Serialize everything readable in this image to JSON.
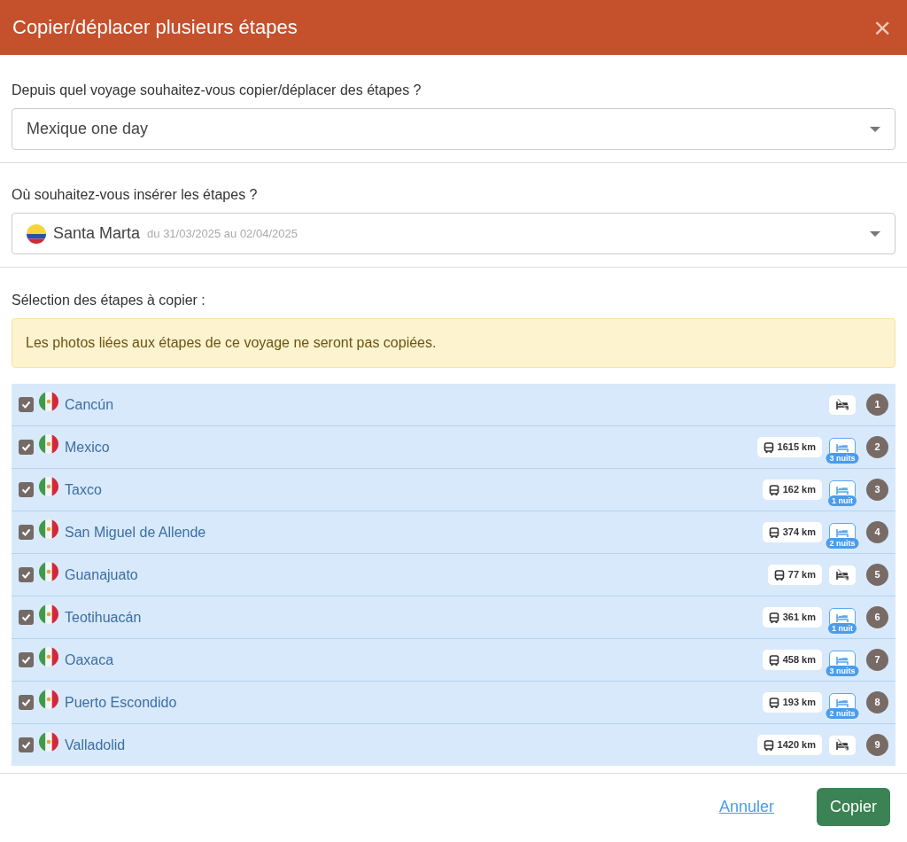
{
  "dialog": {
    "title": "Copier/déplacer plusieurs étapes",
    "close": "×"
  },
  "source": {
    "label": "Depuis quel voyage souhaitez-vous copier/déplacer des étapes ?",
    "value": "Mexique one day"
  },
  "target": {
    "label": "Où souhaitez-vous insérer les étapes ?",
    "value": "Santa Marta",
    "dates": "du 31/03/2025 au 02/04/2025"
  },
  "selection": {
    "label": "Sélection des étapes à copier :",
    "alert": "Les photos liées aux étapes de ce voyage ne seront pas copiées."
  },
  "steps": [
    {
      "name": "Cancún",
      "checked": true,
      "number": "1"
    },
    {
      "name": "Mexico",
      "checked": true,
      "distance": "1615 km",
      "nights": "3 nuits",
      "number": "2"
    },
    {
      "name": "Taxco",
      "checked": true,
      "distance": "162 km",
      "nights": "1 nuit",
      "number": "3"
    },
    {
      "name": "San Miguel de Allende",
      "checked": true,
      "distance": "374 km",
      "nights": "2 nuits",
      "number": "4"
    },
    {
      "name": "Guanajuato",
      "checked": true,
      "distance": "77 km",
      "number": "5"
    },
    {
      "name": "Teotihuacán",
      "checked": true,
      "distance": "361 km",
      "nights": "1 nuit",
      "number": "6"
    },
    {
      "name": "Oaxaca",
      "checked": true,
      "distance": "458 km",
      "nights": "3 nuits",
      "number": "7"
    },
    {
      "name": "Puerto Escondido",
      "checked": true,
      "distance": "193 km",
      "nights": "2 nuits",
      "number": "8"
    },
    {
      "name": "Valladolid",
      "checked": true,
      "distance": "1420 km",
      "number": "9"
    }
  ],
  "footer": {
    "cancel": "Annuler",
    "confirm": "Copier"
  }
}
